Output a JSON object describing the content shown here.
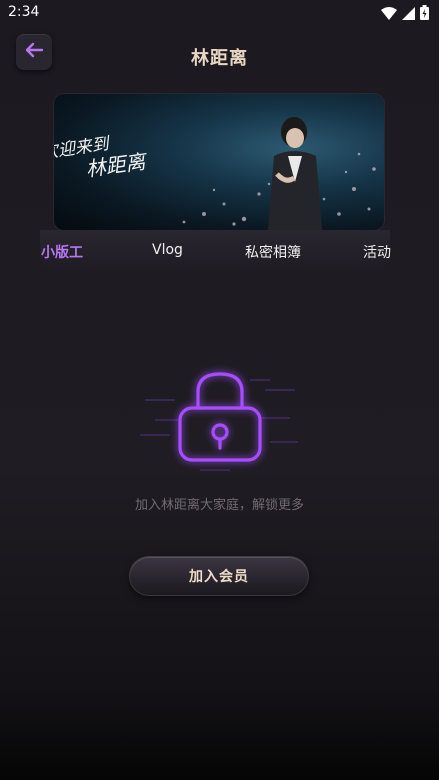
{
  "status_bar": {
    "time": "2:34",
    "icons": [
      "wifi-icon",
      "signal-icon",
      "battery-icon"
    ]
  },
  "header": {
    "title": "林距离",
    "back_icon": "arrow-left-icon"
  },
  "banner": {
    "line1": "欢迎来到",
    "line2": "林距离"
  },
  "tabs": [
    {
      "label": "小版工",
      "active": true
    },
    {
      "label": "Vlog",
      "active": false
    },
    {
      "label": "私密相簿",
      "active": false
    },
    {
      "label": "活动",
      "active": false
    }
  ],
  "locked_state": {
    "icon": "lock-icon",
    "message": "加入林距离大家庭，解锁更多",
    "button_label": "加入会员"
  },
  "colors": {
    "accent": "#b677f0",
    "title": "#e8d5c2",
    "lock_glow": "#a64dff",
    "background": "#1e1b22"
  }
}
